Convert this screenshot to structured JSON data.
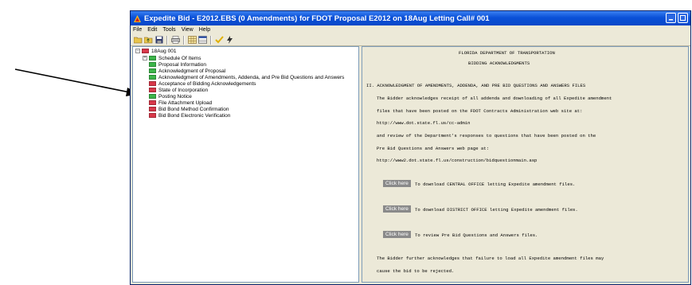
{
  "window": {
    "title": "Expedite Bid - E2012.EBS (0 Amendments) for FDOT Proposal E2012 on 18Aug Letting Call# 001",
    "menu": [
      "File",
      "Edit",
      "Tools",
      "View",
      "Help"
    ],
    "toolbar_icons": [
      "open-folder-icon",
      "folder-up-icon",
      "save-icon",
      "print-icon",
      "grid-icon",
      "table-icon",
      "check-icon",
      "lightning-icon"
    ]
  },
  "tree": {
    "root": {
      "label": "18Aug 001",
      "color": "#d8384a"
    },
    "items": [
      {
        "label": "Schedule Of Items",
        "color": "#3cb54a"
      },
      {
        "label": "Proposal Information",
        "color": "#3cb54a"
      },
      {
        "label": "Acknowledgment of Proposal",
        "color": "#3cb54a"
      },
      {
        "label": "Acknowledgment of Amendments, Addenda, and Pre Bid Questions and Answers",
        "color": "#3cb54a"
      },
      {
        "label": "Acceptance of Bidding Acknowledgements",
        "color": "#d8384a"
      },
      {
        "label": "State of Incorporation",
        "color": "#d8384a"
      },
      {
        "label": "Posting Notice",
        "color": "#3cb54a"
      },
      {
        "label": "File Attachment Upload",
        "color": "#d8384a"
      },
      {
        "label": "Bid Bond Method Confirmation",
        "color": "#d8384a"
      },
      {
        "label": "Bid Bond Electronic Verification",
        "color": "#d8384a"
      }
    ]
  },
  "document": {
    "heading1": "FLORIDA DEPARTMENT OF TRANSPORTATION",
    "heading2": "BIDDING ACKNOWLEDGMENTS",
    "section": "II. ACKNOWLEDGMENT OF AMENDMENTS, ADDENDA, AND PRE BID QUESTIONS AND ANSWERS FILES",
    "p1": "The Bidder acknowledges receipt of all addenda and downloading of all Expedite amendment",
    "p2": "files that have been posted on the FDOT Contracts Administration web site at:",
    "url1": "http://www.dot.state.fl.us/cc-admin",
    "p3": "and review of the Department's responses to questions that have been posted on the",
    "p4": "Pre Bid Questions and Answers web page at:",
    "url2": "http://www2.dot.state.fl.us/construction/bidquestionmain.asp",
    "buttons": [
      {
        "label": "Click here",
        "text": "To download CENTRAL OFFICE letting Expedite amendment files."
      },
      {
        "label": "Click here",
        "text": "To download DISTRICT OFFICE letting Expedite amendment files."
      },
      {
        "label": "Click here",
        "text": "To review Pre Bid Questions and Answers files."
      }
    ],
    "p5": "The Bidder further acknowledges that failure to load all Expedite amendment files may",
    "p6": "cause the bid to be rejected."
  }
}
